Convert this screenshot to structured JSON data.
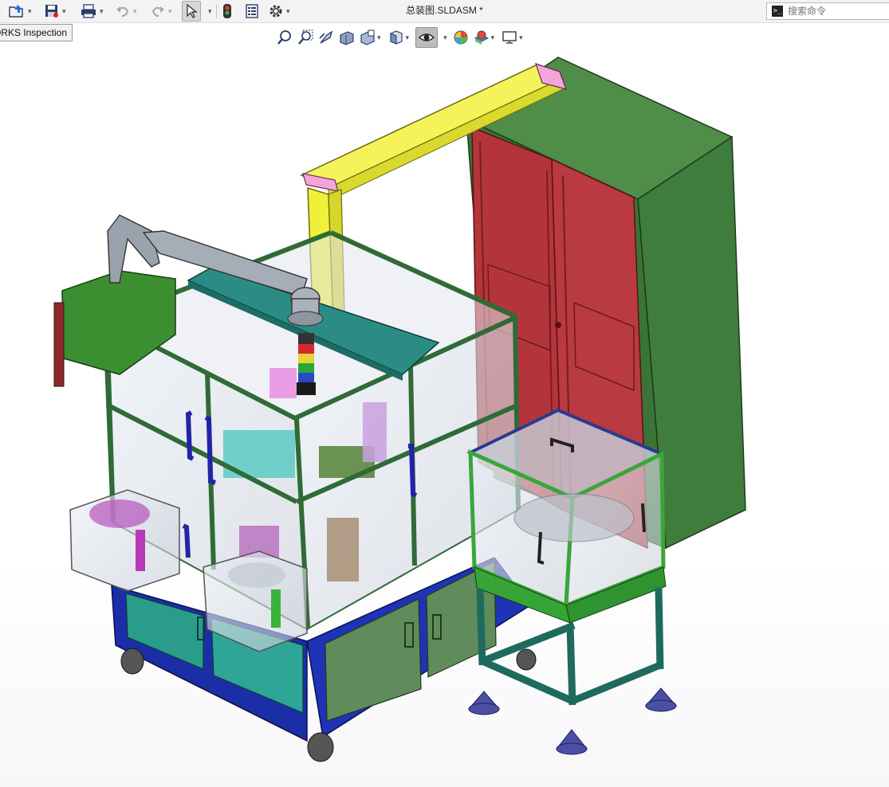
{
  "window": {
    "document_title": "总装图.SLDASM *"
  },
  "quick_access": {
    "items": [
      {
        "name": "open",
        "icon": "open-folder-icon",
        "has_dropdown": true
      },
      {
        "name": "save",
        "icon": "save-icon",
        "has_dropdown": true
      },
      {
        "name": "print",
        "icon": "print-icon",
        "has_dropdown": true
      },
      {
        "name": "undo",
        "icon": "undo-icon",
        "has_dropdown": true
      },
      {
        "name": "redo",
        "icon": "redo-icon",
        "has_dropdown": true
      },
      {
        "name": "select",
        "icon": "cursor-arrow-icon",
        "has_dropdown": true,
        "active": true
      },
      {
        "name": "rebuild",
        "icon": "traffic-light-icon",
        "has_dropdown": false
      },
      {
        "name": "file-properties",
        "icon": "file-properties-icon",
        "has_dropdown": false
      },
      {
        "name": "options",
        "icon": "gear-icon",
        "has_dropdown": true
      }
    ]
  },
  "search": {
    "placeholder": "搜索命令",
    "icon": "command-prompt-icon"
  },
  "tooltip_tab": {
    "label": "ORKS Inspection"
  },
  "view_toolbar": {
    "items": [
      {
        "name": "zoom-to-fit",
        "icon": "zoom-fit-icon"
      },
      {
        "name": "zoom-to-area",
        "icon": "zoom-area-icon"
      },
      {
        "name": "previous-view",
        "icon": "previous-view-icon"
      },
      {
        "name": "section-view",
        "icon": "section-view-icon"
      },
      {
        "name": "dynamic-annotation-views",
        "icon": "annotation-view-icon",
        "has_dropdown": true
      },
      {
        "name": "view-orientation",
        "icon": "view-cube-icon",
        "has_dropdown": true
      },
      {
        "name": "display-style",
        "icon": "eye-display-icon",
        "has_dropdown": true,
        "active": true
      },
      {
        "name": "edit-appearance",
        "icon": "appearance-sphere-icon",
        "has_dropdown": true
      },
      {
        "name": "apply-scene",
        "icon": "scene-icon",
        "has_dropdown": true
      },
      {
        "name": "view-settings",
        "icon": "monitor-icon",
        "has_dropdown": true
      }
    ]
  },
  "model": {
    "description_colors": {
      "frame": "#2f6b36",
      "base": "#1b2ea8",
      "cabinet": "#3f7d3c",
      "cabinet_doors": "#b3353b",
      "gantry_beam": "#f0f03a",
      "plate": "#2b8c86",
      "feeder_frame": "#3aa63a"
    }
  }
}
